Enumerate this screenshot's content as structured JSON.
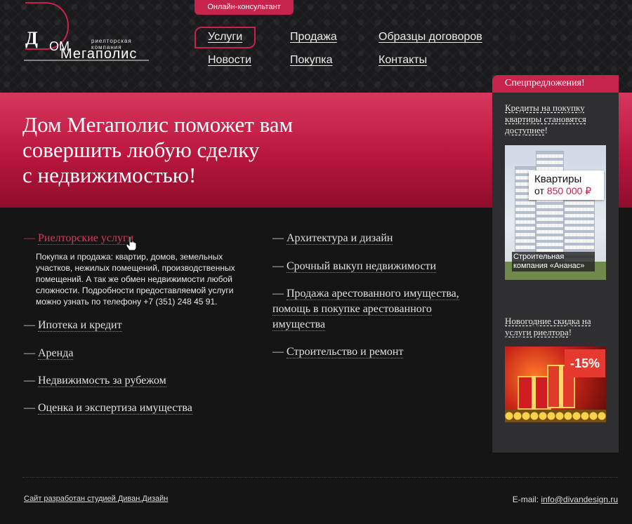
{
  "header": {
    "consult_tab": "Онлайн-консультант",
    "logo": {
      "letter_d": "Д",
      "om": "ОМ",
      "tagline": "риелторская компания",
      "megapolis": "Мегаполис"
    },
    "nav": [
      {
        "label": "Услуги",
        "active": true
      },
      {
        "label": "Продажа"
      },
      {
        "label": "Образцы договоров"
      },
      {
        "label": "Новости"
      },
      {
        "label": "Покупка"
      },
      {
        "label": "Контакты"
      }
    ]
  },
  "banner": {
    "title_lines": [
      "Дом Мегаполис поможет вам",
      "совершить любую сделку",
      "с недвижимостью!"
    ]
  },
  "services": {
    "left": [
      {
        "label": "Риелторские услуги",
        "active": true
      },
      {
        "label": "Ипотека и кредит"
      },
      {
        "label": "Аренда"
      },
      {
        "label": "Недвижимость за рубежом"
      },
      {
        "label": "Оценка и экспертиза имущества"
      }
    ],
    "active_description": "Покупка и продажа: квартир, домов, земельных участков, нежилых помещений, производственных помещений. А так же обмен недвижимости любой сложности. Подробности предоставляемой услуги можно узнать по телефону +7 (351) 248 45 91.",
    "right": [
      {
        "label": "Архитектура и дизайн"
      },
      {
        "label": "Срочный выкуп недвижимости"
      },
      {
        "label": "Продажа арестованного имущества, помощь в покупке арестованного имущества"
      },
      {
        "label": "Строительство и ремонт"
      }
    ],
    "dash": "—"
  },
  "sidebar": {
    "title": "Спецпредложения!",
    "promo1": {
      "link_text": "Кредиты на покупку квартиры становятся доступнее",
      "suffix": "!",
      "price_line1": "Квартиры",
      "price_prefix": "от",
      "price_value": "850 000 ₽",
      "caption": "Строительная компания «Ананас»"
    },
    "promo2": {
      "link_text": "Новогодние скидка на услуги риелтора",
      "suffix": "!",
      "discount": "-15%"
    }
  },
  "footer": {
    "credit": "Сайт разработан студией Диван.Дизайн",
    "email_label": "E-mail:",
    "email": "info@divandesign.ru"
  },
  "colors": {
    "accent": "#c8234a",
    "background": "#161516",
    "sidebar": "#2f2e30"
  }
}
